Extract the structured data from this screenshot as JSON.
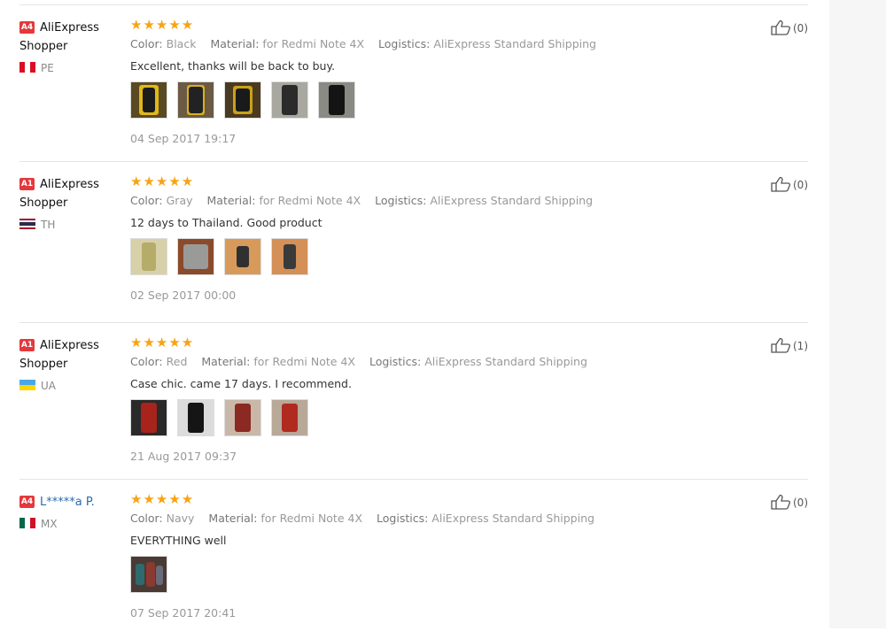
{
  "accent_colors": {
    "star": "#f7a313",
    "badge": "#e4393c",
    "link": "#2a6bb0"
  },
  "labels": {
    "color": "Color:",
    "material": "Material:",
    "logistics": "Logistics:"
  },
  "reviews": [
    {
      "level": "A4",
      "name": "AliExpress Shopper",
      "country": "PE",
      "flag": "peru",
      "stars": "★★★★★",
      "rating": 5,
      "color": "Black",
      "material": "for Redmi Note 4X",
      "logistics": "AliExpress Standard Shipping",
      "text": "Excellent, thanks will be back to buy.",
      "photos": 5,
      "date": "04 Sep 2017 19:17",
      "helpful": "(0)"
    },
    {
      "level": "A1",
      "name": "AliExpress Shopper",
      "country": "TH",
      "flag": "thailand",
      "stars": "★★★★★",
      "rating": 5,
      "color": "Gray",
      "material": "for Redmi Note 4X",
      "logistics": "AliExpress Standard Shipping",
      "text": "12 days to Thailand. Good product",
      "photos": 4,
      "date": "02 Sep 2017 00:00",
      "helpful": "(0)"
    },
    {
      "level": "A1",
      "name": "AliExpress Shopper",
      "country": "UA",
      "flag": "ukraine",
      "stars": "★★★★★",
      "rating": 5,
      "color": "Red",
      "material": "for Redmi Note 4X",
      "logistics": "AliExpress Standard Shipping",
      "text": "Case chic. came 17 days. I recommend.",
      "photos": 4,
      "date": "21 Aug 2017 09:37",
      "helpful": "(1)"
    },
    {
      "level": "A4",
      "name": "L*****a P.",
      "country": "MX",
      "flag": "mexico",
      "stars": "★★★★★",
      "rating": 5,
      "color": "Navy",
      "material": "for Redmi Note 4X",
      "logistics": "AliExpress Standard Shipping",
      "text": "EVERYTHING well",
      "photos": 1,
      "date": "07 Sep 2017 20:41",
      "helpful": "(0)"
    }
  ]
}
